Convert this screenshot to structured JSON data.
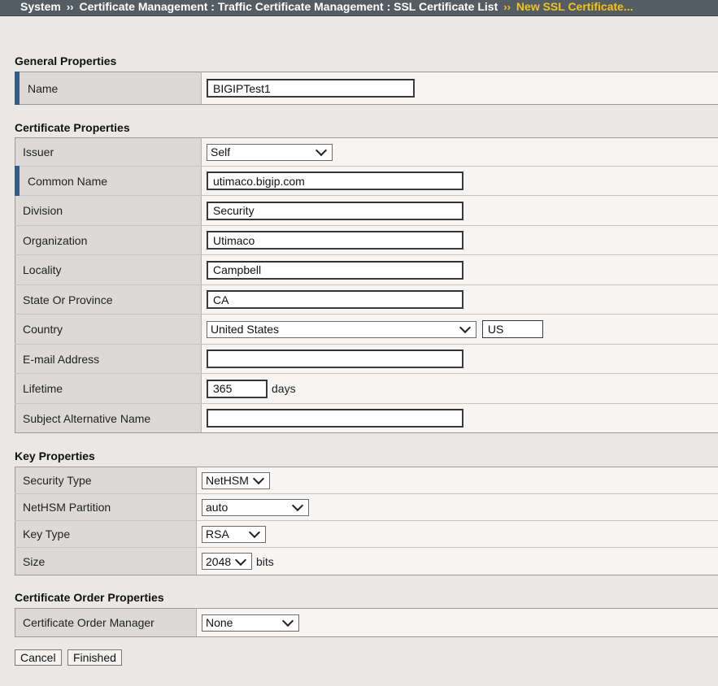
{
  "breadcrumb": {
    "items": [
      "System",
      "Certificate Management : Traffic Certificate Management : SSL Certificate List"
    ],
    "current": "New SSL Certificate...",
    "separator": "››"
  },
  "general": {
    "heading": "General Properties",
    "name_label": "Name",
    "name_value": "BIGIPTest1"
  },
  "certificate": {
    "heading": "Certificate Properties",
    "issuer_label": "Issuer",
    "issuer_value": "Self",
    "common_name_label": "Common Name",
    "common_name_value": "utimaco.bigip.com",
    "division_label": "Division",
    "division_value": "Security",
    "organization_label": "Organization",
    "organization_value": "Utimaco",
    "locality_label": "Locality",
    "locality_value": "Campbell",
    "state_label": "State Or Province",
    "state_value": "CA",
    "country_label": "Country",
    "country_value": "United States",
    "country_code": "US",
    "email_label": "E-mail Address",
    "email_value": "",
    "lifetime_label": "Lifetime",
    "lifetime_value": "365",
    "lifetime_unit": "days",
    "san_label": "Subject Alternative Name",
    "san_value": ""
  },
  "key": {
    "heading": "Key Properties",
    "security_type_label": "Security Type",
    "security_type_value": "NetHSM",
    "partition_label": "NetHSM Partition",
    "partition_value": "auto",
    "key_type_label": "Key Type",
    "key_type_value": "RSA",
    "size_label": "Size",
    "size_value": "2048",
    "size_unit": "bits"
  },
  "order": {
    "heading": "Certificate Order Properties",
    "manager_label": "Certificate Order Manager",
    "manager_value": "None"
  },
  "buttons": {
    "cancel": "Cancel",
    "finished": "Finished"
  },
  "colors": {
    "breadcrumb_bg": "#545d64",
    "breadcrumb_current": "#f0c419",
    "required_marker": "#2f5e8e",
    "page_bg": "#eae8e4"
  }
}
